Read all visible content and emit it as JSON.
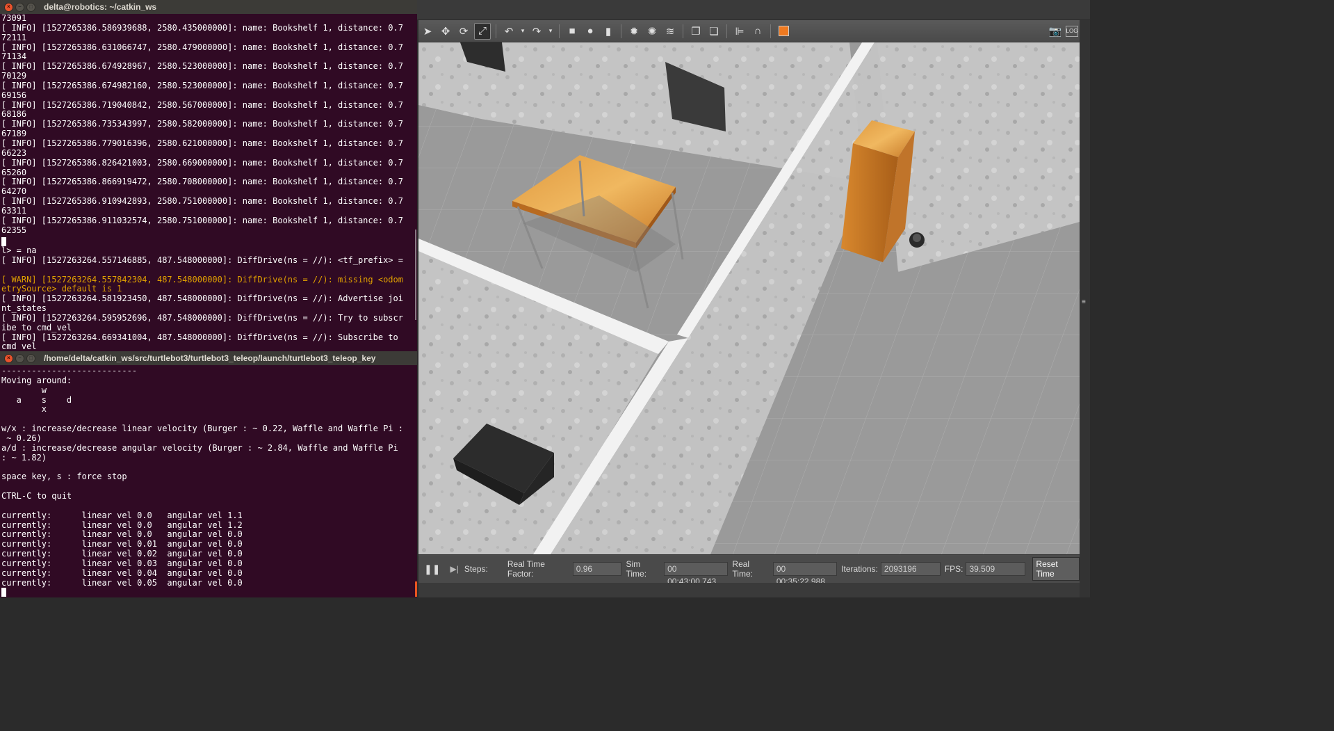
{
  "term1": {
    "title": "delta@robotics: ~/catkin_ws",
    "top_lines": [
      "73091",
      "[ INFO] [1527265386.586939688, 2580.435000000]: name: Bookshelf 1, distance: 0.7",
      "72111",
      "[ INFO] [1527265386.631066747, 2580.479000000]: name: Bookshelf 1, distance: 0.7",
      "71134",
      "[ INFO] [1527265386.674928967, 2580.523000000]: name: Bookshelf 1, distance: 0.7",
      "70129",
      "[ INFO] [1527265386.674982160, 2580.523000000]: name: Bookshelf 1, distance: 0.7",
      "69156",
      "[ INFO] [1527265386.719040842, 2580.567000000]: name: Bookshelf 1, distance: 0.7",
      "68186",
      "[ INFO] [1527265386.735343997, 2580.582000000]: name: Bookshelf 1, distance: 0.7",
      "67189",
      "[ INFO] [1527265386.779016396, 2580.621000000]: name: Bookshelf 1, distance: 0.7",
      "66223",
      "[ INFO] [1527265386.826421003, 2580.669000000]: name: Bookshelf 1, distance: 0.7",
      "65260",
      "[ INFO] [1527265386.866919472, 2580.708000000]: name: Bookshelf 1, distance: 0.7",
      "64270",
      "[ INFO] [1527265386.910942893, 2580.751000000]: name: Bookshelf 1, distance: 0.7",
      "63311",
      "[ INFO] [1527265386.911032574, 2580.751000000]: name: Bookshelf 1, distance: 0.7",
      "62355"
    ],
    "bottom_lines": [
      "l> = na",
      "[ INFO] [1527263264.557146885, 487.548000000]: DiffDrive(ns = //): <tf_prefix> =",
      "",
      "[ WARN] [1527263264.557842304, 487.548000000]: DiffDrive(ns = //): missing <odom",
      "etrySource> default is 1",
      "[ INFO] [1527263264.581923450, 487.548000000]: DiffDrive(ns = //): Advertise joi",
      "nt_states",
      "[ INFO] [1527263264.595952696, 487.548000000]: DiffDrive(ns = //): Try to subscr",
      "ibe to cmd_vel",
      "[ INFO] [1527263264.669341004, 487.548000000]: DiffDrive(ns = //): Subscribe to",
      "cmd_vel"
    ]
  },
  "term2": {
    "title": "/home/delta/catkin_ws/src/turtlebot3/turtlebot3_teleop/launch/turtlebot3_teleop_key",
    "lines": [
      "---------------------------",
      "Moving around:",
      "        w",
      "   a    s    d",
      "        x",
      "",
      "w/x : increase/decrease linear velocity (Burger : ~ 0.22, Waffle and Waffle Pi :",
      " ~ 0.26)",
      "a/d : increase/decrease angular velocity (Burger : ~ 2.84, Waffle and Waffle Pi",
      ": ~ 1.82)",
      "",
      "space key, s : force stop",
      "",
      "CTRL-C to quit",
      "",
      "currently:      linear vel 0.0   angular vel 1.1",
      "currently:      linear vel 0.0   angular vel 1.2",
      "currently:      linear vel 0.0   angular vel 0.0",
      "currently:      linear vel 0.01  angular vel 0.0",
      "currently:      linear vel 0.02  angular vel 0.0",
      "currently:      linear vel 0.03  angular vel 0.0",
      "currently:      linear vel 0.04  angular vel 0.0",
      "currently:      linear vel 0.05  angular vel 0.0"
    ]
  },
  "gazebo": {
    "steps_label": "Steps:",
    "rtf_label": "Real Time Factor:",
    "rtf_value": "0.96",
    "sim_time_label": "Sim Time:",
    "sim_time_value": "00 00:43:00.743",
    "real_time_label": "Real Time:",
    "real_time_value": "00 00:35:22.988",
    "iterations_label": "Iterations:",
    "iterations_value": "2093196",
    "fps_label": "FPS:",
    "fps_value": "39.509",
    "reset_label": "Reset Time",
    "screenshot_icon": "camera-icon",
    "log_icon": "log-icon",
    "log_text": "LOG"
  }
}
